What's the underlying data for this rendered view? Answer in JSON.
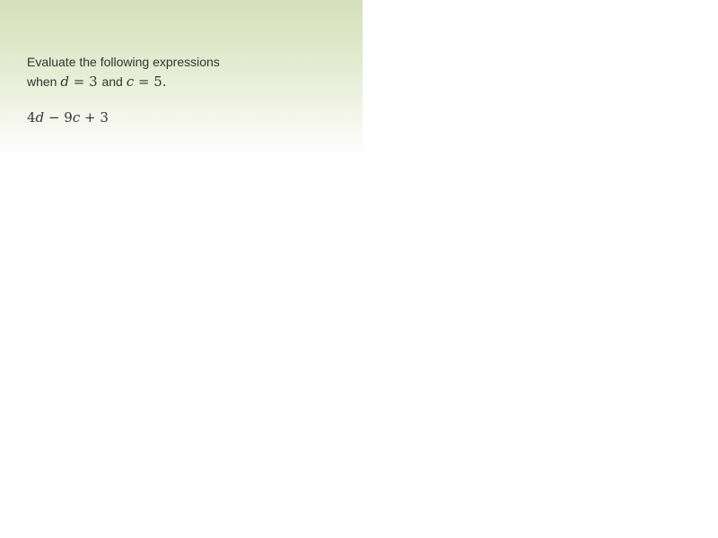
{
  "prompt": {
    "line1": "Evaluate the following expressions",
    "when_word": "when",
    "var1": "d",
    "eq1": "=",
    "val1": "3",
    "and_word": "and",
    "var2": "c",
    "eq2": "=",
    "val2": "5",
    "period": "."
  },
  "expression": {
    "coef1": "4",
    "var1": "d",
    "op1": "−",
    "coef2": "9",
    "var2": "c",
    "op2": "+",
    "const": "3"
  }
}
